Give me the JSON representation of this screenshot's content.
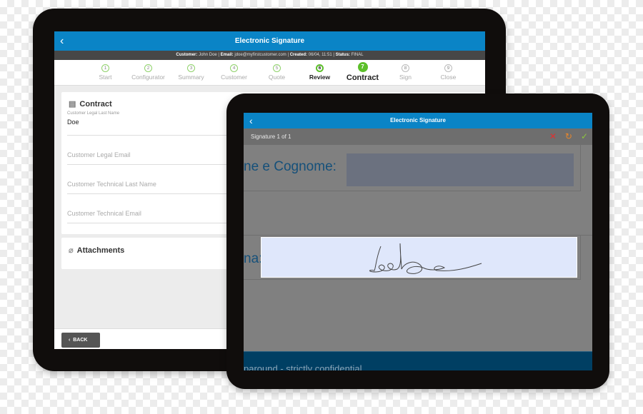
{
  "main_app": {
    "header": {
      "title": "Electronic Signature",
      "back_icon": "chevron-left-icon"
    },
    "info_bar": {
      "customer_label": "Customer:",
      "customer": "John Doe",
      "email_label": "Email:",
      "email": "jdoe@myfirstcustomer.com",
      "created_label": "Created:",
      "created": "06/04, 11:51",
      "status_label": "Status:",
      "status": "FINAL"
    },
    "steps": [
      {
        "n": "1",
        "label": "Start",
        "state": "done"
      },
      {
        "n": "2",
        "label": "Configurator",
        "state": "done"
      },
      {
        "n": "3",
        "label": "Summary",
        "state": "done"
      },
      {
        "n": "4",
        "label": "Customer",
        "state": "done"
      },
      {
        "n": "5",
        "label": "Quote",
        "state": "done"
      },
      {
        "n": "6",
        "label": "Review",
        "state": "cur"
      },
      {
        "n": "7",
        "label": "Contract",
        "state": "act"
      },
      {
        "n": "8",
        "label": "Sign",
        "state": "fut"
      },
      {
        "n": "9",
        "label": "Close",
        "state": "fut"
      }
    ],
    "contract": {
      "title": "Contract",
      "fields": [
        {
          "label": "Customer Legal Last Name",
          "value": "Doe"
        },
        {
          "placeholder": "Customer Legal Email"
        },
        {
          "placeholder": "Customer Technical Last Name"
        },
        {
          "placeholder": "Customer Technical Email"
        }
      ]
    },
    "attachments": {
      "title": "Attachments"
    },
    "footer": {
      "back": "BACK"
    }
  },
  "signature_app": {
    "header": {
      "title": "Electronic Signature"
    },
    "subheader": {
      "label": "Signature 1 of 1",
      "cancel": "✕",
      "reset": "↻",
      "confirm": "✓"
    },
    "colors": {
      "cancel": "#e03030",
      "reset": "#e8862a",
      "confirm": "#8cc63f"
    },
    "doc": {
      "name_label": "ne e Cognome:",
      "sign_label": "na:",
      "footer_text": "paround - strictly confidential"
    }
  }
}
